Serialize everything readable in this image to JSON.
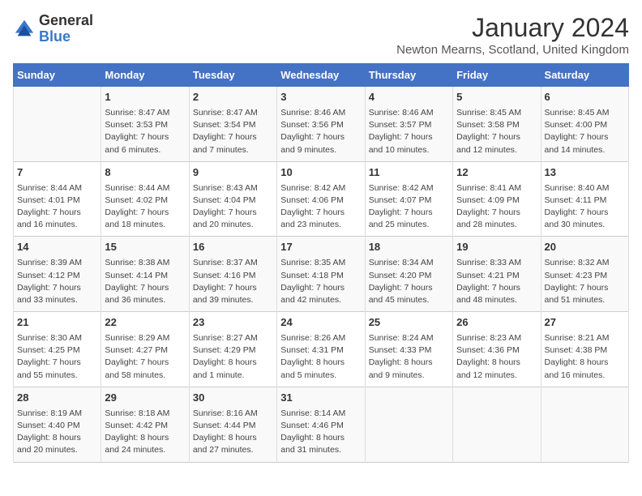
{
  "header": {
    "logo_general": "General",
    "logo_blue": "Blue",
    "month_title": "January 2024",
    "subtitle": "Newton Mearns, Scotland, United Kingdom"
  },
  "days_of_week": [
    "Sunday",
    "Monday",
    "Tuesday",
    "Wednesday",
    "Thursday",
    "Friday",
    "Saturday"
  ],
  "weeks": [
    [
      {
        "day": "",
        "info": ""
      },
      {
        "day": "1",
        "info": "Sunrise: 8:47 AM\nSunset: 3:53 PM\nDaylight: 7 hours\nand 6 minutes."
      },
      {
        "day": "2",
        "info": "Sunrise: 8:47 AM\nSunset: 3:54 PM\nDaylight: 7 hours\nand 7 minutes."
      },
      {
        "day": "3",
        "info": "Sunrise: 8:46 AM\nSunset: 3:56 PM\nDaylight: 7 hours\nand 9 minutes."
      },
      {
        "day": "4",
        "info": "Sunrise: 8:46 AM\nSunset: 3:57 PM\nDaylight: 7 hours\nand 10 minutes."
      },
      {
        "day": "5",
        "info": "Sunrise: 8:45 AM\nSunset: 3:58 PM\nDaylight: 7 hours\nand 12 minutes."
      },
      {
        "day": "6",
        "info": "Sunrise: 8:45 AM\nSunset: 4:00 PM\nDaylight: 7 hours\nand 14 minutes."
      }
    ],
    [
      {
        "day": "7",
        "info": "Sunrise: 8:44 AM\nSunset: 4:01 PM\nDaylight: 7 hours\nand 16 minutes."
      },
      {
        "day": "8",
        "info": "Sunrise: 8:44 AM\nSunset: 4:02 PM\nDaylight: 7 hours\nand 18 minutes."
      },
      {
        "day": "9",
        "info": "Sunrise: 8:43 AM\nSunset: 4:04 PM\nDaylight: 7 hours\nand 20 minutes."
      },
      {
        "day": "10",
        "info": "Sunrise: 8:42 AM\nSunset: 4:06 PM\nDaylight: 7 hours\nand 23 minutes."
      },
      {
        "day": "11",
        "info": "Sunrise: 8:42 AM\nSunset: 4:07 PM\nDaylight: 7 hours\nand 25 minutes."
      },
      {
        "day": "12",
        "info": "Sunrise: 8:41 AM\nSunset: 4:09 PM\nDaylight: 7 hours\nand 28 minutes."
      },
      {
        "day": "13",
        "info": "Sunrise: 8:40 AM\nSunset: 4:11 PM\nDaylight: 7 hours\nand 30 minutes."
      }
    ],
    [
      {
        "day": "14",
        "info": "Sunrise: 8:39 AM\nSunset: 4:12 PM\nDaylight: 7 hours\nand 33 minutes."
      },
      {
        "day": "15",
        "info": "Sunrise: 8:38 AM\nSunset: 4:14 PM\nDaylight: 7 hours\nand 36 minutes."
      },
      {
        "day": "16",
        "info": "Sunrise: 8:37 AM\nSunset: 4:16 PM\nDaylight: 7 hours\nand 39 minutes."
      },
      {
        "day": "17",
        "info": "Sunrise: 8:35 AM\nSunset: 4:18 PM\nDaylight: 7 hours\nand 42 minutes."
      },
      {
        "day": "18",
        "info": "Sunrise: 8:34 AM\nSunset: 4:20 PM\nDaylight: 7 hours\nand 45 minutes."
      },
      {
        "day": "19",
        "info": "Sunrise: 8:33 AM\nSunset: 4:21 PM\nDaylight: 7 hours\nand 48 minutes."
      },
      {
        "day": "20",
        "info": "Sunrise: 8:32 AM\nSunset: 4:23 PM\nDaylight: 7 hours\nand 51 minutes."
      }
    ],
    [
      {
        "day": "21",
        "info": "Sunrise: 8:30 AM\nSunset: 4:25 PM\nDaylight: 7 hours\nand 55 minutes."
      },
      {
        "day": "22",
        "info": "Sunrise: 8:29 AM\nSunset: 4:27 PM\nDaylight: 7 hours\nand 58 minutes."
      },
      {
        "day": "23",
        "info": "Sunrise: 8:27 AM\nSunset: 4:29 PM\nDaylight: 8 hours\nand 1 minute."
      },
      {
        "day": "24",
        "info": "Sunrise: 8:26 AM\nSunset: 4:31 PM\nDaylight: 8 hours\nand 5 minutes."
      },
      {
        "day": "25",
        "info": "Sunrise: 8:24 AM\nSunset: 4:33 PM\nDaylight: 8 hours\nand 9 minutes."
      },
      {
        "day": "26",
        "info": "Sunrise: 8:23 AM\nSunset: 4:36 PM\nDaylight: 8 hours\nand 12 minutes."
      },
      {
        "day": "27",
        "info": "Sunrise: 8:21 AM\nSunset: 4:38 PM\nDaylight: 8 hours\nand 16 minutes."
      }
    ],
    [
      {
        "day": "28",
        "info": "Sunrise: 8:19 AM\nSunset: 4:40 PM\nDaylight: 8 hours\nand 20 minutes."
      },
      {
        "day": "29",
        "info": "Sunrise: 8:18 AM\nSunset: 4:42 PM\nDaylight: 8 hours\nand 24 minutes."
      },
      {
        "day": "30",
        "info": "Sunrise: 8:16 AM\nSunset: 4:44 PM\nDaylight: 8 hours\nand 27 minutes."
      },
      {
        "day": "31",
        "info": "Sunrise: 8:14 AM\nSunset: 4:46 PM\nDaylight: 8 hours\nand 31 minutes."
      },
      {
        "day": "",
        "info": ""
      },
      {
        "day": "",
        "info": ""
      },
      {
        "day": "",
        "info": ""
      }
    ]
  ]
}
